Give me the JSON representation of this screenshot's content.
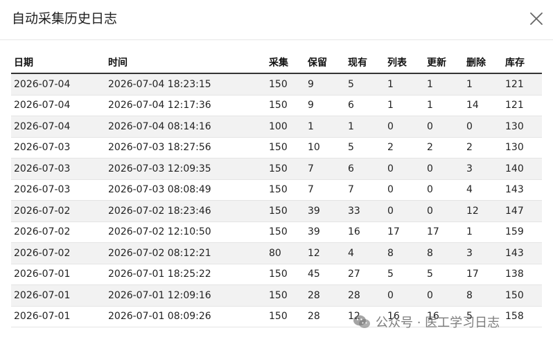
{
  "dialog": {
    "title": "自动采集历史日志",
    "close_icon": "close-icon"
  },
  "table": {
    "headers": [
      "日期",
      "时间",
      "采集",
      "保留",
      "现有",
      "列表",
      "更新",
      "删除",
      "库存"
    ],
    "rows": [
      [
        "2026-07-04",
        "2026-07-04 18:23:15",
        "150",
        "9",
        "5",
        "1",
        "1",
        "1",
        "121"
      ],
      [
        "2026-07-04",
        "2026-07-04 12:17:36",
        "150",
        "9",
        "6",
        "1",
        "1",
        "14",
        "121"
      ],
      [
        "2026-07-04",
        "2026-07-04 08:14:16",
        "100",
        "1",
        "1",
        "0",
        "0",
        "0",
        "130"
      ],
      [
        "2026-07-03",
        "2026-07-03 18:27:56",
        "150",
        "10",
        "5",
        "2",
        "2",
        "2",
        "130"
      ],
      [
        "2026-07-03",
        "2026-07-03 12:09:35",
        "150",
        "7",
        "6",
        "0",
        "0",
        "3",
        "140"
      ],
      [
        "2026-07-03",
        "2026-07-03 08:08:49",
        "150",
        "7",
        "7",
        "0",
        "0",
        "4",
        "143"
      ],
      [
        "2026-07-02",
        "2026-07-02 18:23:46",
        "150",
        "39",
        "33",
        "0",
        "0",
        "12",
        "147"
      ],
      [
        "2026-07-02",
        "2026-07-02 12:10:50",
        "150",
        "39",
        "16",
        "17",
        "17",
        "1",
        "159"
      ],
      [
        "2026-07-02",
        "2026-07-02 08:12:21",
        "80",
        "12",
        "4",
        "8",
        "8",
        "3",
        "143"
      ],
      [
        "2026-07-01",
        "2026-07-01 18:25:22",
        "150",
        "45",
        "27",
        "5",
        "5",
        "17",
        "138"
      ],
      [
        "2026-07-01",
        "2026-07-01 12:09:16",
        "150",
        "28",
        "28",
        "0",
        "0",
        "8",
        "150"
      ],
      [
        "2026-07-01",
        "2026-07-01 08:09:26",
        "150",
        "28",
        "12",
        "16",
        "16",
        "5",
        "158"
      ]
    ]
  },
  "watermark": {
    "icon": "wechat-icon",
    "text": "公众号 · 医工学习日志"
  }
}
